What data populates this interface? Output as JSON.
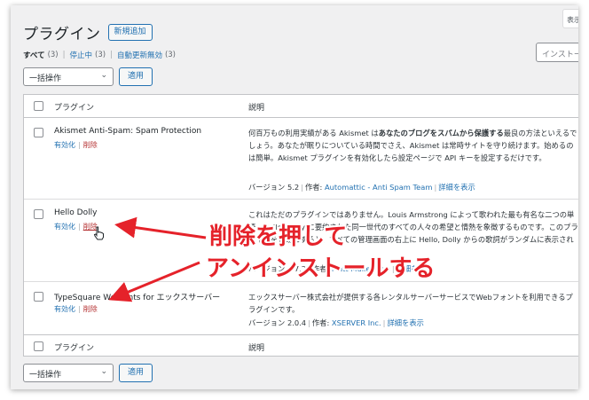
{
  "header": {
    "title": "プラグイン",
    "add_new": "新規追加",
    "screen_options": "表示",
    "search_placeholder": "インストール"
  },
  "filters": [
    {
      "label": "すべて",
      "count": "(3)",
      "current": true
    },
    {
      "label": "停止中",
      "count": "(3)",
      "current": false
    },
    {
      "label": "自動更新無効",
      "count": "(3)",
      "current": false
    }
  ],
  "bulk": {
    "selected": "一括操作",
    "apply": "適用"
  },
  "table": {
    "col_name": "プラグイン",
    "col_desc": "説明",
    "rows": [
      {
        "name": "Akismet Anti-Spam: Spam Protection",
        "activate": "有効化",
        "delete": "削除",
        "desc_parts": [
          "何百万もの利用実績がある Akismet は",
          "あなたのブログをスパムから保護する",
          "最良の方法といえるでしょう。あなたが眠りについている時間でさえ、Akismet は常時サイトを守り続けます。始めるのは簡単。Akismet プラグインを有効化したら設定ページで API キーを設定するだけです。"
        ],
        "version": "バージョン 5.2",
        "author_label": "作者:",
        "author": "Automattic - Anti Spam Team",
        "details": "詳細を表示"
      },
      {
        "name": "Hello Dolly",
        "activate": "有効化",
        "delete": "削除",
        "desc": "これはただのプラグインではありません。Louis Armstrong によって歌われた最も有名な二つの単語、Hello, Dolly に要約された同一世代のすべての人々の希望と情熱を象徴するものです。このプラグインを有効にすると、すべての管理画面の右上に Hello, Dolly からの歌詞がランダムに表示されます。",
        "version": "バージョン 1.7.2",
        "author_label": "作者:",
        "author": "Matt Mullenweg",
        "details": "詳細を表示"
      },
      {
        "name": "TypeSquare Webfonts for エックスサーバー",
        "activate": "有効化",
        "delete": "削除",
        "desc": "エックスサーバー株式会社が提供する各レンタルサーバーサービスでWebフォントを利用できるプラグインです。",
        "version": "バージョン 2.0.4",
        "author_label": "作者:",
        "author": "XSERVER Inc.",
        "details": "詳細を表示"
      }
    ]
  },
  "annotation": {
    "line1": "削除を押して",
    "line2": "アンインストールする",
    "color": "#e5222a"
  }
}
